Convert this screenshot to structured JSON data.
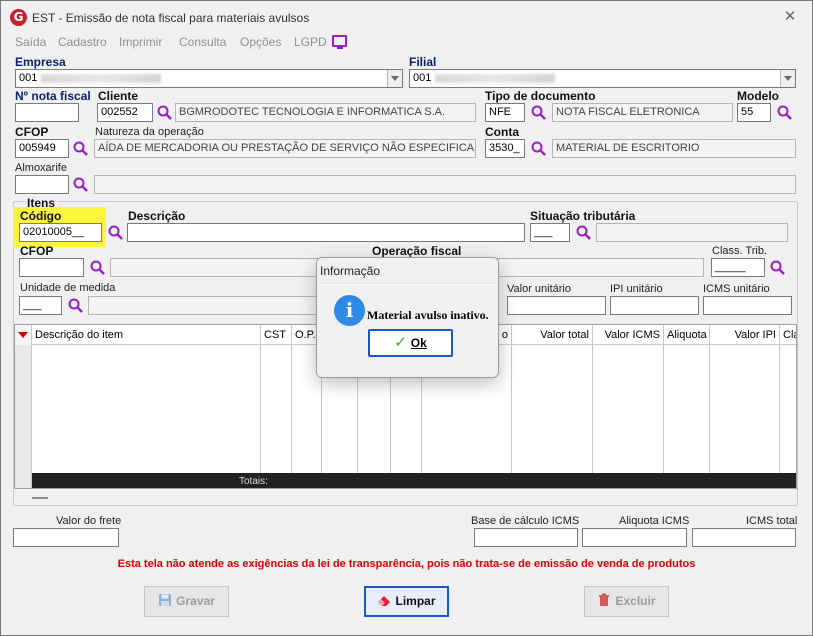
{
  "window": {
    "title": "EST - Emissão de nota fiscal para materiais avulsos",
    "icon_letter": "G",
    "close_glyph": "✕"
  },
  "menu": [
    "Saída",
    "Cadastro",
    "Imprimir",
    "Consulta",
    "Opções",
    "LGPD"
  ],
  "header": {
    "empresa_label": "Empresa",
    "empresa_value": "001",
    "filial_label": "Filial",
    "filial_value": "001",
    "nota_fiscal_label": "Nº nota fiscal",
    "cliente_label": "Cliente",
    "cliente_code": "002552",
    "cliente_name": "BGMRODOTEC TECNOLOGIA E INFORMATICA S.A.",
    "tipo_doc_label": "Tipo de documento",
    "tipo_doc_code": "NFE",
    "tipo_doc_name": "NOTA FISCAL ELETRONICA",
    "modelo_label": "Modelo",
    "modelo_value": "55",
    "cfop_label": "CFOP",
    "cfop_value": "005949",
    "natureza_label": "Natureza da operação",
    "natureza_value": "AÍDA DE MERCADORIA OU PRESTAÇÃO DE SERVIÇO NÃO ESPECIFICADO",
    "conta_label": "Conta",
    "conta_code": "3530_",
    "conta_name": "MATERIAL DE ESCRITORIO",
    "almoxarife_label": "Almoxarife"
  },
  "itens": {
    "group_label": "Itens",
    "codigo_label": "Código",
    "codigo_value": "02010005__",
    "descricao_label": "Descrição",
    "situacao_label": "Situação tributária",
    "situacao_value": "___",
    "cfop_label": "CFOP",
    "operacao_label": "Operação fiscal",
    "class_trib_label": "Class. Trib.",
    "class_trib_value": "_____",
    "unidade_label": "Unidade de medida",
    "unidade_value": "___",
    "valor_unitario_label": "Valor unitário",
    "ipi_unitario_label": "IPI unitário",
    "icms_unitario_label": "ICMS unitário"
  },
  "grid": {
    "columns": [
      "Descrição do item",
      "CST",
      "O.P.",
      "o",
      "Valor total",
      "Valor ICMS",
      "Aliquota",
      "Valor IPI",
      "Cla"
    ],
    "totals_label": "Totais:"
  },
  "footer": {
    "frete_label": "Valor do frete",
    "base_icms_label": "Base de cálculo ICMS",
    "aliquota_icms_label": "Aliquota ICMS",
    "icms_total_label": "ICMS total",
    "warning": "Esta tela não atende as exigências da lei de transparência, pois não trata-se de emissão de venda de produtos"
  },
  "buttons": {
    "gravar": "Gravar",
    "limpar": "Limpar",
    "excluir": "Excluir"
  },
  "dialog": {
    "title": "Informação",
    "message": "Material avulso inativo.",
    "ok": "Ok",
    "info_glyph": "i"
  },
  "colors": {
    "accent_blue": "#1c56c8",
    "warning_red": "#e00000",
    "highlight_yellow": "#fcf33c",
    "search_icon": "#9b1cc9"
  }
}
